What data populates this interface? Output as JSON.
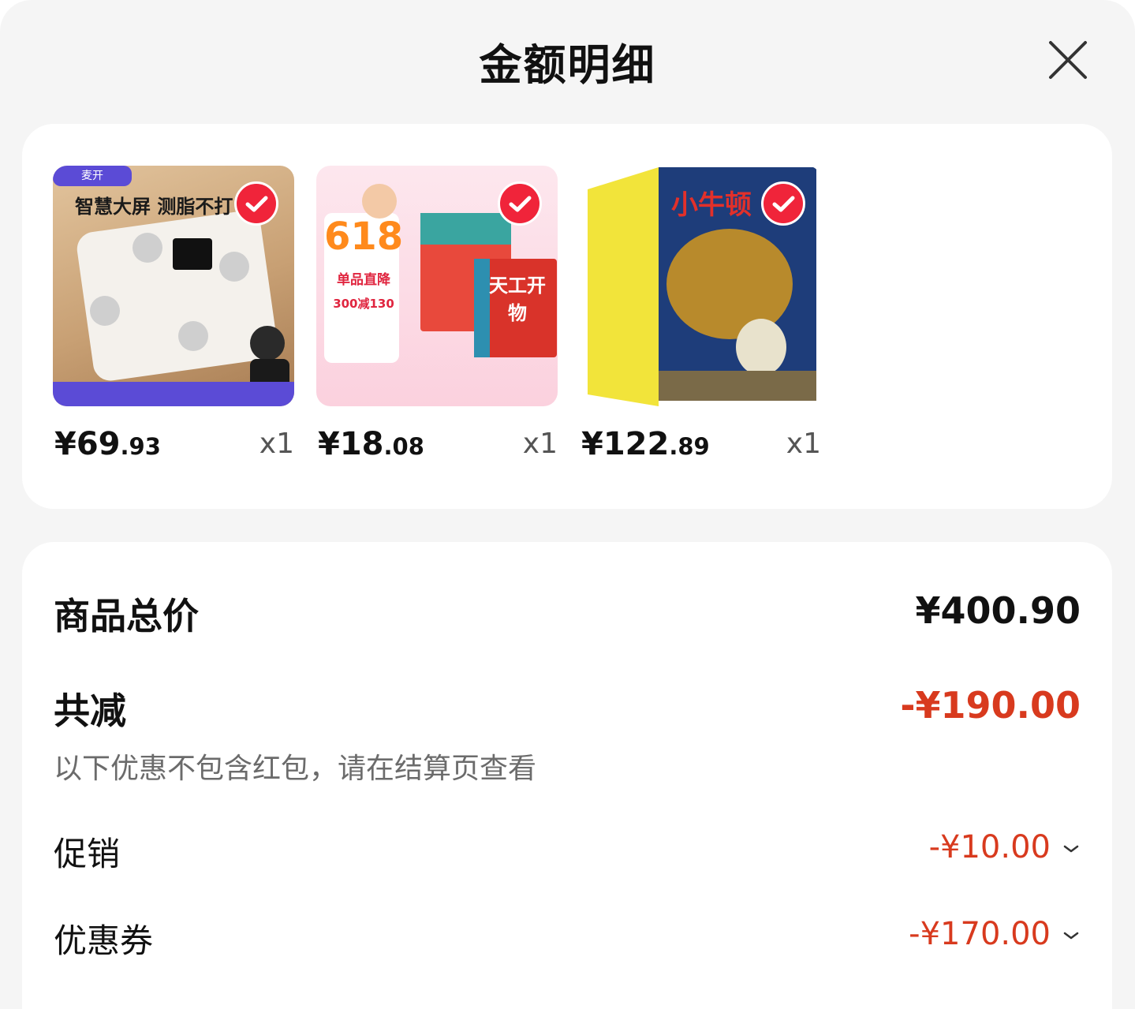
{
  "header": {
    "title": "金额明细"
  },
  "products": [
    {
      "price_currency": "¥",
      "price_int": "69",
      "price_dec": ".93",
      "qty": "x1",
      "thumb_text": "智慧大屏 测脂不打",
      "brand_text": "麦开"
    },
    {
      "price_currency": "¥",
      "price_int": "18",
      "price_dec": ".08",
      "qty": "x1",
      "badge": "618",
      "line1": "单品直降",
      "line2": "300减130",
      "book_title": "天工开物"
    },
    {
      "price_currency": "¥",
      "price_int": "122",
      "price_dec": ".89",
      "qty": "x1",
      "cover_title": "小牛顿"
    }
  ],
  "summary": {
    "total_label": "商品总价",
    "total_value": "¥400.90",
    "reduce_label": "共减",
    "reduce_value": "-¥190.00",
    "hint": "以下优惠不包含红包，请在结算页查看",
    "promo_label": "促销",
    "promo_value": "-¥10.00",
    "coupon_label": "优惠券",
    "coupon_value": "-¥170.00"
  },
  "colors": {
    "discount_red": "#d83a1e",
    "check_red": "#f0243a",
    "page_bg": "#f5f5f5"
  }
}
